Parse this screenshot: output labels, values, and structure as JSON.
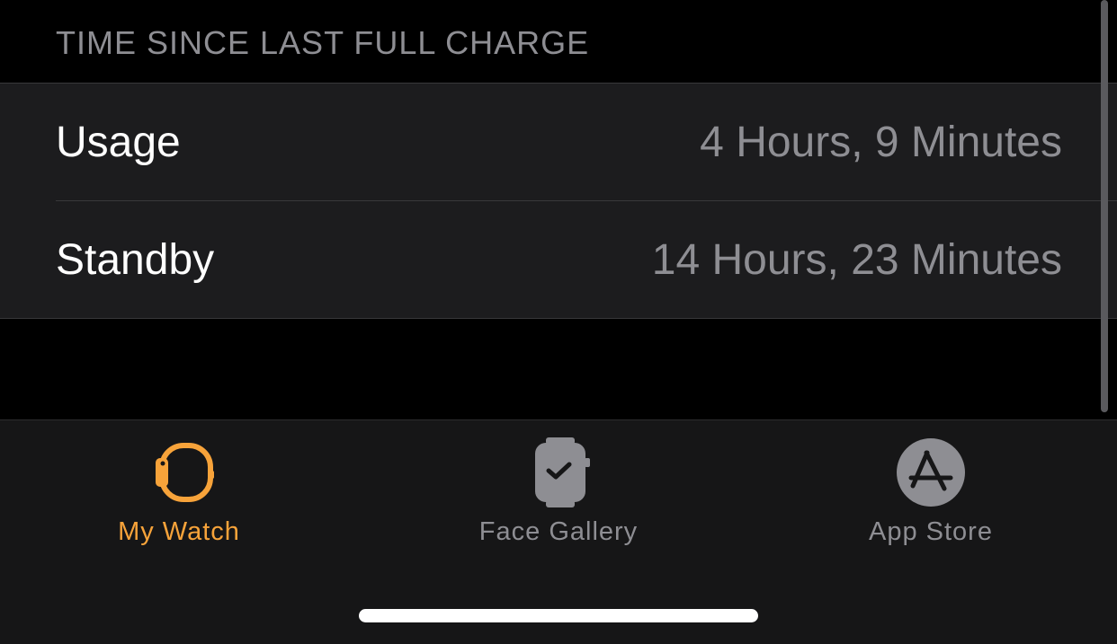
{
  "section": {
    "header": "TIME SINCE LAST FULL CHARGE"
  },
  "rows": [
    {
      "label": "Usage",
      "value": "4 Hours, 9 Minutes"
    },
    {
      "label": "Standby",
      "value": "14 Hours, 23 Minutes"
    }
  ],
  "tabbar": {
    "tabs": [
      {
        "label": "My Watch",
        "icon": "watch-outline-icon",
        "selected": true
      },
      {
        "label": "Face Gallery",
        "icon": "watch-face-icon",
        "selected": false
      },
      {
        "label": "App Store",
        "icon": "app-store-icon",
        "selected": false
      }
    ]
  },
  "colors": {
    "accent": "#F7A33A",
    "inactive": "#8E8E93",
    "background": "#000000",
    "row_background": "#1C1C1E"
  }
}
